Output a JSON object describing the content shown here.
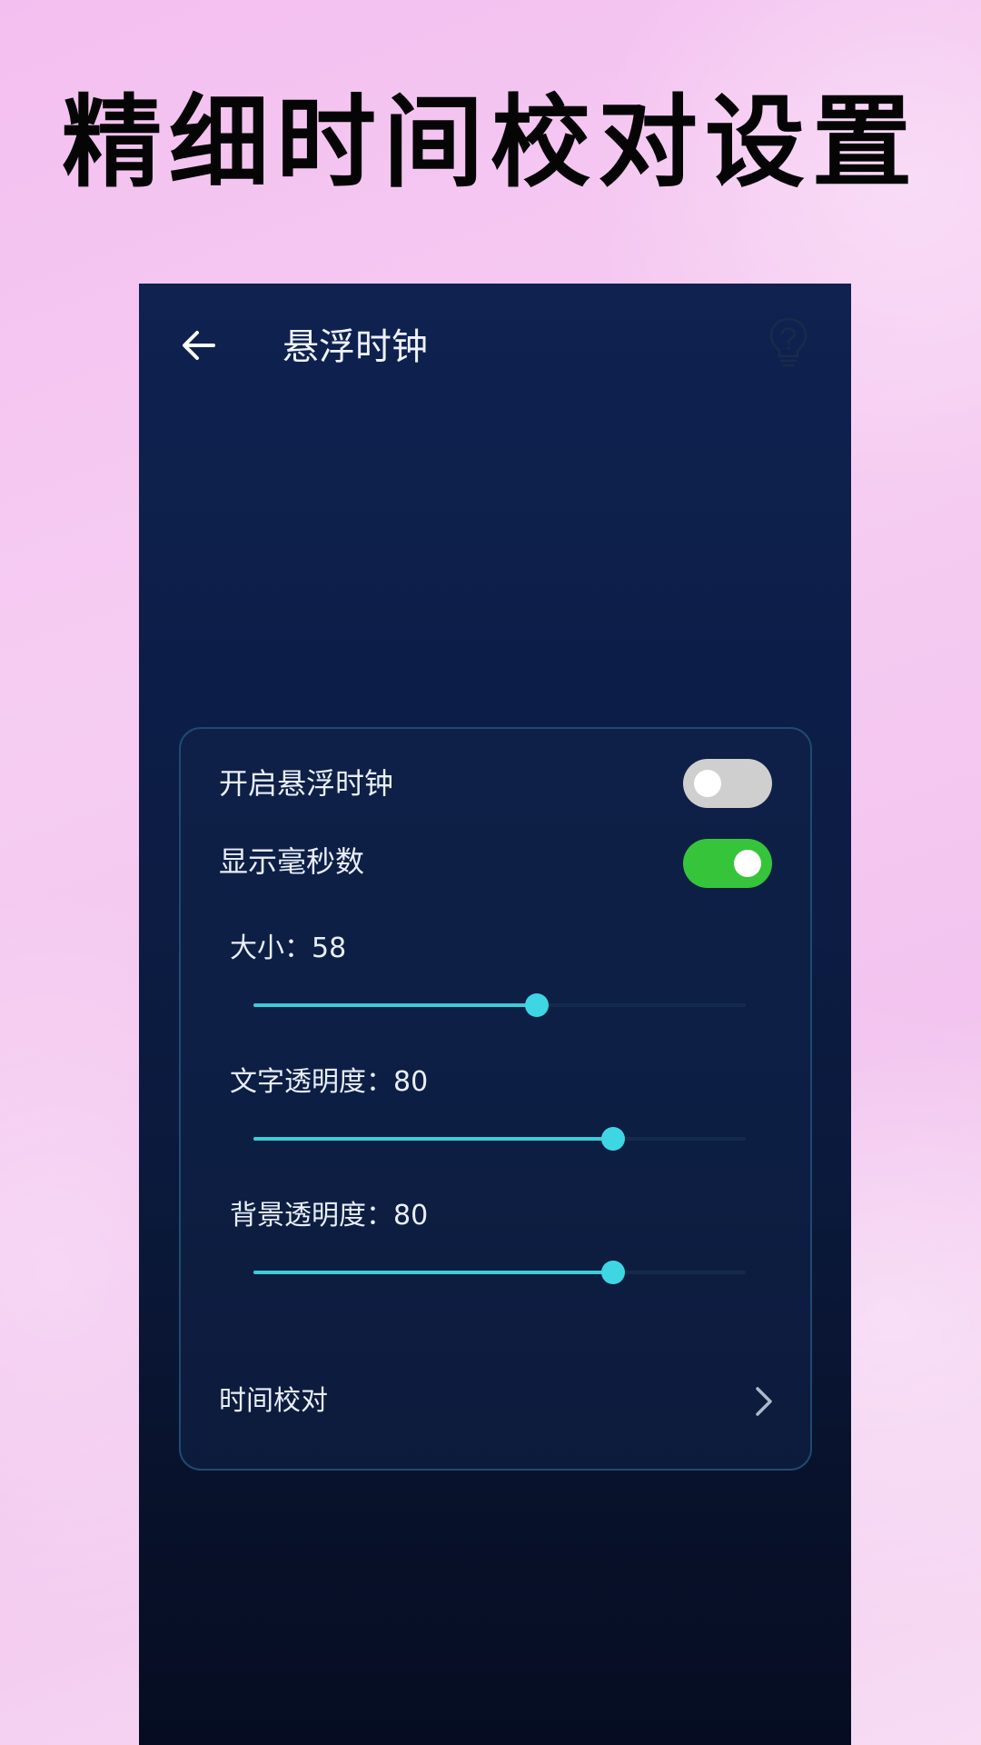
{
  "headline": "精细时间校对设置",
  "app": {
    "title": "悬浮时钟",
    "back_icon": "arrow-left-icon",
    "help_icon": "lightbulb-question-icon"
  },
  "settings": {
    "float_clock": {
      "label": "开启悬浮时钟",
      "enabled": false
    },
    "show_ms": {
      "label": "显示毫秒数",
      "enabled": true
    },
    "sliders": [
      {
        "label": "大小：58",
        "value": 58,
        "fraction": 0.575
      },
      {
        "label": "文字透明度：80",
        "value": 80,
        "fraction": 0.73
      },
      {
        "label": "背景透明度：80",
        "value": 80,
        "fraction": 0.73
      }
    ],
    "time_calibration": {
      "label": "时间校对",
      "icon": "chevron-right-icon"
    }
  },
  "colors": {
    "accent": "#3ed6e2",
    "toggle_on": "#36c53a",
    "toggle_off": "#cfcfcf",
    "card_border": "#1f4a73"
  }
}
